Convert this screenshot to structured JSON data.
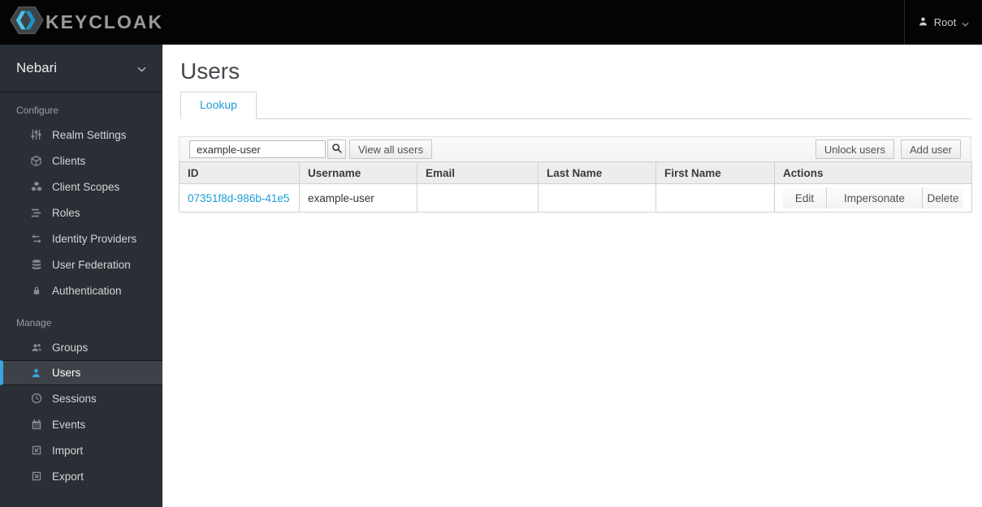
{
  "topbar": {
    "logo_text": "KEYCLOAK",
    "user": "Root"
  },
  "sidebar": {
    "realm": "Nebari",
    "sections": [
      {
        "label": "Configure",
        "items": [
          {
            "label": "Realm Settings",
            "icon": "sliders-icon"
          },
          {
            "label": "Clients",
            "icon": "cube-icon"
          },
          {
            "label": "Client Scopes",
            "icon": "cubes-icon"
          },
          {
            "label": "Roles",
            "icon": "list-icon"
          },
          {
            "label": "Identity Providers",
            "icon": "exchange-icon"
          },
          {
            "label": "User Federation",
            "icon": "database-icon"
          },
          {
            "label": "Authentication",
            "icon": "lock-icon"
          }
        ]
      },
      {
        "label": "Manage",
        "items": [
          {
            "label": "Groups",
            "icon": "users-icon"
          },
          {
            "label": "Users",
            "icon": "user-icon",
            "active": true
          },
          {
            "label": "Sessions",
            "icon": "clock-icon"
          },
          {
            "label": "Events",
            "icon": "calendar-icon"
          },
          {
            "label": "Import",
            "icon": "import-icon"
          },
          {
            "label": "Export",
            "icon": "export-icon"
          }
        ]
      }
    ]
  },
  "main": {
    "title": "Users",
    "tabs": [
      {
        "label": "Lookup",
        "active": true
      }
    ],
    "toolbar": {
      "search_value": "example-user",
      "view_all": "View all users",
      "unlock": "Unlock users",
      "add": "Add user"
    },
    "table": {
      "columns": [
        "ID",
        "Username",
        "Email",
        "Last Name",
        "First Name",
        "Actions"
      ],
      "rows": [
        {
          "id": "07351f8d-986b-41e5…",
          "username": "example-user",
          "email": "",
          "last_name": "",
          "first_name": "",
          "actions": [
            "Edit",
            "Impersonate",
            "Delete"
          ]
        }
      ]
    }
  },
  "colors": {
    "accent_blue": "#39a5dc",
    "link_blue": "#1b9dd9",
    "topbar_bg": "#040404",
    "sidebar_bg": "#2a2e35",
    "sidebar_active_bg": "#3d4248",
    "table_header_bg": "#ededed",
    "table_border": "#d1d1d1"
  }
}
